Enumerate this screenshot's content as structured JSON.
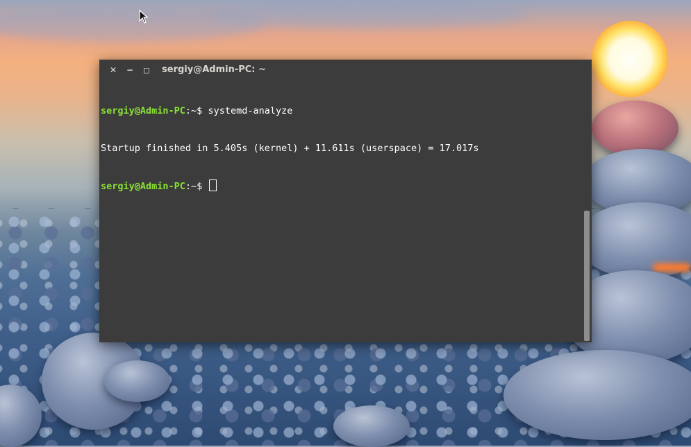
{
  "window": {
    "title": "sergiy@Admin-PC: ~",
    "close_glyph": "✕",
    "minimize_glyph": "−",
    "maximize_glyph": "◻"
  },
  "terminal": {
    "prompt_user": "sergiy@Admin-PC",
    "prompt_path": ":~$ ",
    "command": "systemd-analyze",
    "output": "Startup finished in 5.405s (kernel) + 11.611s (userspace) = 17.017s"
  },
  "colors": {
    "terminal_bg": "#3c3c3c",
    "prompt_green": "#8ae234",
    "text": "#ffffff"
  },
  "icons": {
    "cursor": "mouse-pointer-icon",
    "close": "close-icon",
    "minimize": "minimize-icon",
    "maximize": "maximize-icon"
  }
}
